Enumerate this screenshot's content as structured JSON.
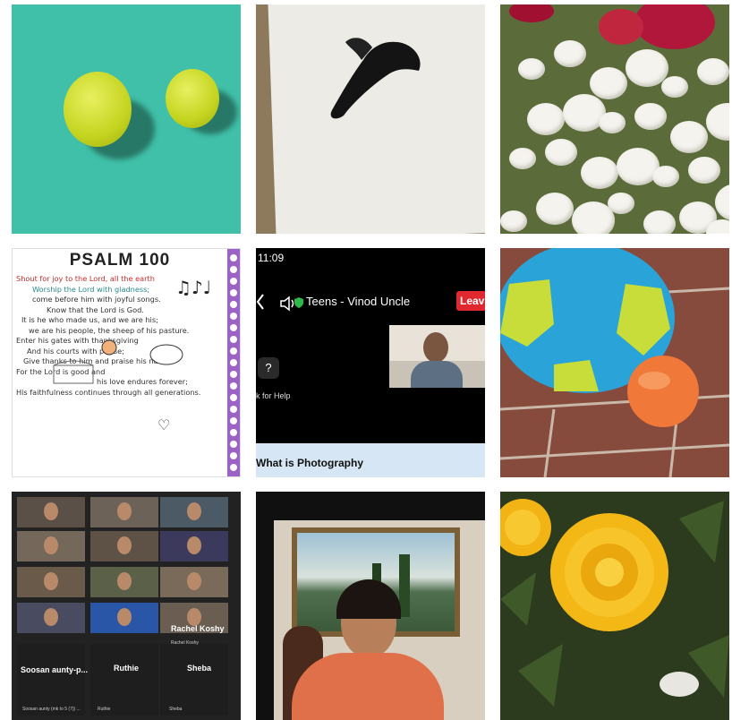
{
  "psalm": {
    "title": "PSALM 100",
    "lines": [
      "Shout for joy to the Lord, all the earth",
      "Worship the Lord with gladness;",
      "come before him with joyful songs.",
      "Know that the Lord is God.",
      "It is he who made us, and we are his;",
      "we are his people, the sheep of his pasture.",
      "",
      "",
      "",
      "",
      "Enter his gates with thanksgiving",
      "And his courts with praise;",
      "Give thanks to him and praise his name.",
      "",
      "For the Lord is good and",
      "his love endures forever;",
      "His faithfulness continues through all generations."
    ]
  },
  "zoom": {
    "status_time": "11:09",
    "meeting_title": "Teens - Vinod Uncle",
    "leave_label": "Leav",
    "help_label": "k for Help",
    "bottom_label": "What is Photography"
  },
  "gallery": {
    "big_names": [
      "Rachel Koshy",
      "Soosan aunty-p...",
      "Ruthie",
      "Sheba"
    ],
    "small_names": [
      "Rachel Koshy",
      "Soosan aunty (mk to 5 (7)) ...",
      "Ruthie",
      "Sheba"
    ]
  }
}
